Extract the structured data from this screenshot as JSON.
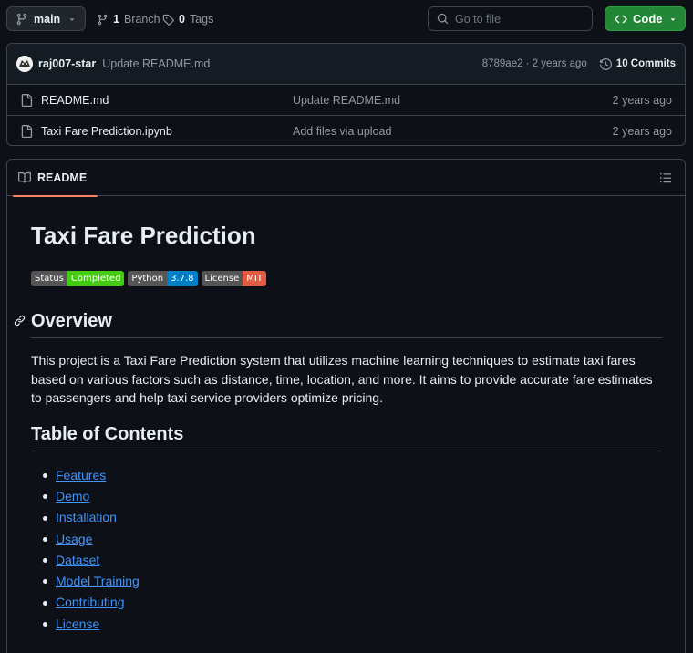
{
  "toolbar": {
    "branch": "main",
    "branch_count": "1",
    "branch_label": "Branch",
    "tag_count": "0",
    "tag_label": "Tags",
    "search_placeholder": "Go to file",
    "code_label": "Code"
  },
  "latest_commit": {
    "author": "raj007-star",
    "message": "Update README.md",
    "hash_age": "8789ae2 · 2 years ago",
    "commits_label": "10 Commits"
  },
  "files": [
    {
      "name": "README.md",
      "commit": "Update README.md",
      "age": "2 years ago"
    },
    {
      "name": "Taxi Fare Prediction.ipynb",
      "commit": "Add files via upload",
      "age": "2 years ago"
    }
  ],
  "readme": {
    "tab_label": "README",
    "title": "Taxi Fare Prediction",
    "badges": [
      {
        "label": "Status",
        "value": "Completed",
        "color": "#4c1"
      },
      {
        "label": "Python",
        "value": "3.7.8",
        "color": "#007ec6"
      },
      {
        "label": "License",
        "value": "MIT",
        "color": "#e05d44"
      }
    ],
    "overview_heading": "Overview",
    "overview_text": "This project is a Taxi Fare Prediction system that utilizes machine learning techniques to estimate taxi fares based on various factors such as distance, time, location, and more. It aims to provide accurate fare estimates to passengers and help taxi service providers optimize pricing.",
    "toc_heading": "Table of Contents",
    "toc": [
      "Features",
      "Demo",
      "Installation",
      "Usage",
      "Dataset",
      "Model Training",
      "Contributing",
      "License"
    ]
  },
  "colors": {
    "background": "#0d1117",
    "border": "#3d444d",
    "accent_green": "#238636",
    "link_blue": "#4493f8",
    "tab_underline": "#f78166"
  }
}
